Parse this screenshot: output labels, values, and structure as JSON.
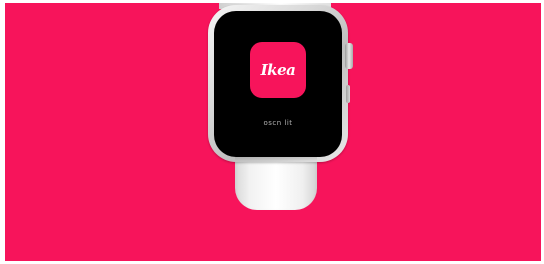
{
  "background_color": "#F7145B",
  "watch": {
    "screen_color": "#000000",
    "app_icon": {
      "logo_text": "Ikea",
      "background_color": "#F7145B",
      "text_color": "#FFFFFF"
    },
    "caption": "oscn lit"
  }
}
